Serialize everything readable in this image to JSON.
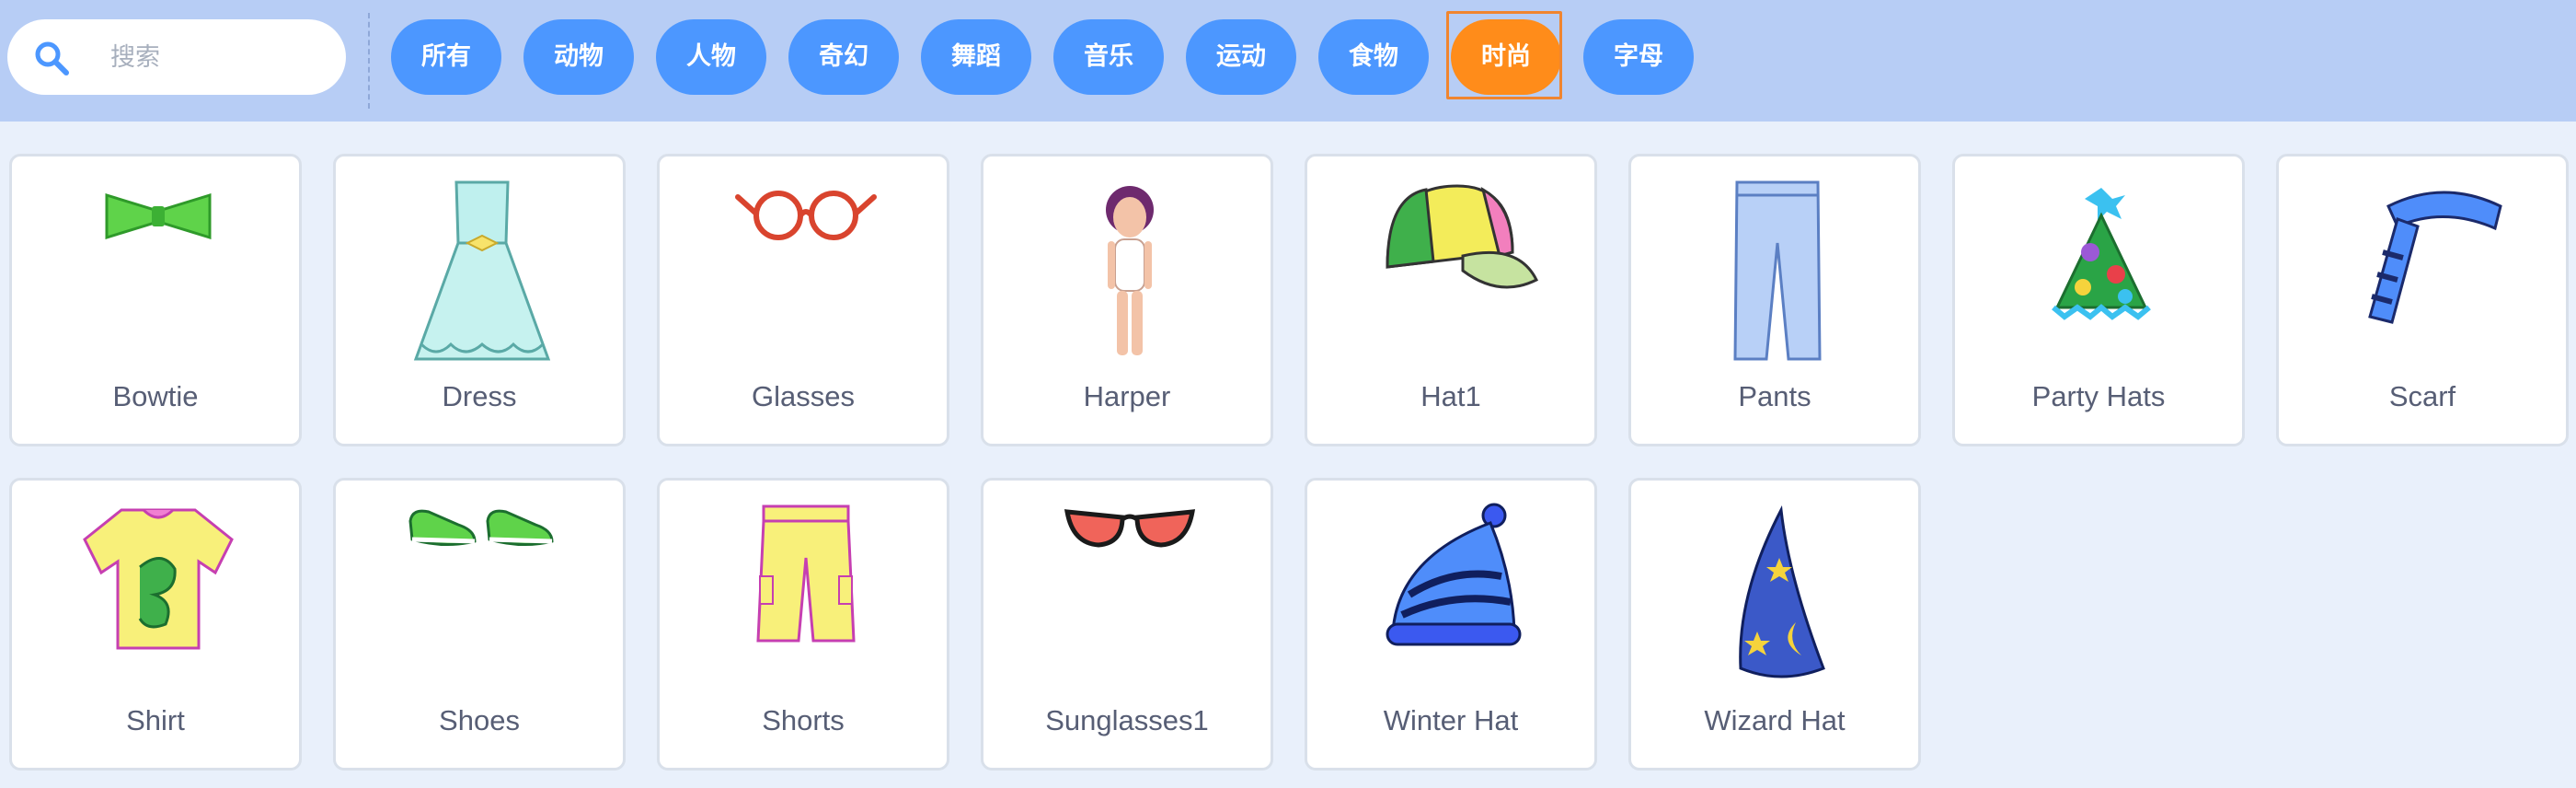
{
  "search": {
    "placeholder": "搜索"
  },
  "categories": [
    "所有",
    "动物",
    "人物",
    "奇幻",
    "舞蹈",
    "音乐",
    "运动",
    "食物",
    "时尚",
    "字母"
  ],
  "selected_category": "时尚",
  "colors": {
    "category_bg": "#4c97ff",
    "category_selected_bg": "#ff8c1a",
    "topbar_bg": "#b7cdf5",
    "page_bg": "#e9f0fb"
  },
  "items": [
    {
      "name": "Bowtie",
      "icon": "bowtie-icon"
    },
    {
      "name": "Dress",
      "icon": "dress-icon"
    },
    {
      "name": "Glasses",
      "icon": "glasses-icon"
    },
    {
      "name": "Harper",
      "icon": "harper-icon"
    },
    {
      "name": "Hat1",
      "icon": "cap-icon"
    },
    {
      "name": "Pants",
      "icon": "pants-icon"
    },
    {
      "name": "Party Hats",
      "icon": "party-hat-icon"
    },
    {
      "name": "Scarf",
      "icon": "scarf-icon"
    },
    {
      "name": "Shirt",
      "icon": "shirt-icon"
    },
    {
      "name": "Shoes",
      "icon": "shoes-icon"
    },
    {
      "name": "Shorts",
      "icon": "shorts-icon"
    },
    {
      "name": "Sunglasses1",
      "icon": "sunglasses-icon"
    },
    {
      "name": "Winter Hat",
      "icon": "winter-hat-icon"
    },
    {
      "name": "Wizard Hat",
      "icon": "wizard-hat-icon"
    }
  ]
}
